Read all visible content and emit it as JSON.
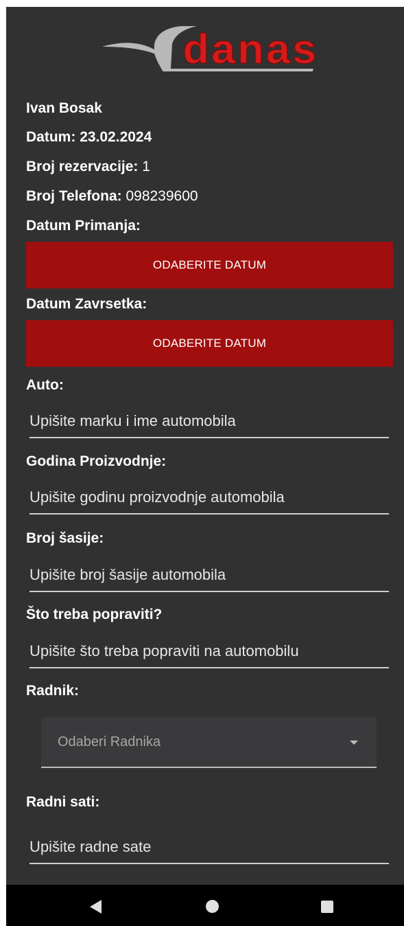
{
  "header": {
    "logo_text": "danas"
  },
  "info": {
    "name": "Ivan Bosak",
    "date_label": "Datum:",
    "date_value": "23.02.2024",
    "reservation_label": "Broj rezervacije:",
    "reservation_value": "1",
    "phone_label": "Broj Telefona:",
    "phone_value": "098239600"
  },
  "form": {
    "receipt_date_label": "Datum Primanja:",
    "receipt_date_button": "ODABERITE DATUM",
    "completion_date_label": "Datum Zavrsetka:",
    "completion_date_button": "ODABERITE DATUM",
    "car_label": "Auto:",
    "car_placeholder": "Upišite marku i ime automobila",
    "year_label": "Godina Proizvodnje:",
    "year_placeholder": "Upišite godinu proizvodnje automobila",
    "chassis_label": "Broj šasije:",
    "chassis_placeholder": "Upišite broj šasije automobila",
    "repair_label": "Što treba popraviti?",
    "repair_placeholder": "Upišite što treba popraviti na automobilu",
    "worker_label": "Radnik:",
    "worker_select": "Odaberi Radnika",
    "hours_label": "Radni sati:",
    "hours_placeholder": "Upišite radne sate"
  },
  "colors": {
    "background": "#313131",
    "accent": "#a10e0e",
    "navbar": "#000000"
  },
  "icons": [
    "back-icon",
    "home-icon",
    "recent-apps-icon",
    "dropdown-caret-icon"
  ]
}
